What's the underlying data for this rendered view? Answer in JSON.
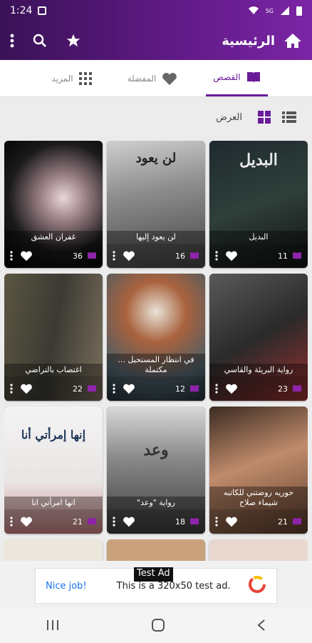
{
  "status_bar": {
    "time": "1:24",
    "signal_label": "5G"
  },
  "app_bar": {
    "title": "الرئيسية"
  },
  "tabs": [
    {
      "label": "القصص",
      "icon": "book-icon",
      "active": true
    },
    {
      "label": "المفضلة",
      "icon": "heart-icon",
      "active": false
    },
    {
      "label": "المزيد",
      "icon": "apps-grid-icon",
      "active": false
    }
  ],
  "view": {
    "label": "العرض"
  },
  "books": [
    {
      "title": "غفران العشق",
      "count": "36",
      "cover_text": ""
    },
    {
      "title": "لن يعود إليها",
      "count": "16",
      "cover_text": "لن يعود"
    },
    {
      "title": "البديل",
      "count": "11",
      "cover_text": "البديل"
    },
    {
      "title": "اغتصاب بالتراضي",
      "count": "22",
      "cover_text": ""
    },
    {
      "title": "في انتظار المستحيل ... مكتملة",
      "count": "12",
      "cover_text": ""
    },
    {
      "title": "رواية البريئة والقاسي",
      "count": "23",
      "cover_text": ""
    },
    {
      "title": "انها امرأتي انا",
      "count": "21",
      "cover_text": "إنها إمرأتي أنا"
    },
    {
      "title": "رواية \"وعد\"",
      "count": "18",
      "cover_text": "وعد"
    },
    {
      "title": "حوريه روضتني للكاتبه شيماء صلاح",
      "count": "21",
      "cover_text": ""
    }
  ],
  "ad": {
    "label": "Test Ad",
    "nice": "Nice job!",
    "message": "This is a 320x50 test ad."
  },
  "colors": {
    "accent": "#6a1b9a",
    "appbar": "#5f1a85"
  }
}
